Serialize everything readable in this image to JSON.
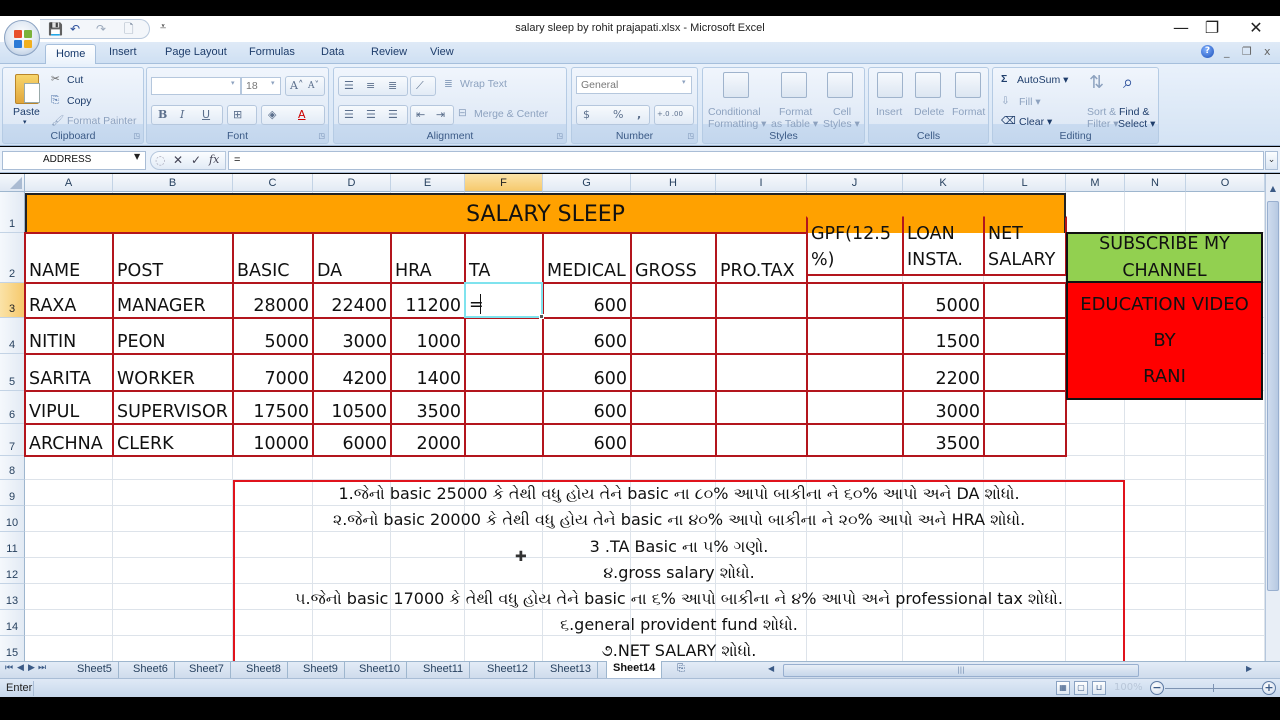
{
  "window": {
    "title": "salary sleep by rohit prajapati.xlsx - Microsoft Excel",
    "controls": {
      "minimize": "—",
      "restore": "❐",
      "close": "✕"
    },
    "doc_controls": {
      "help": "?",
      "minimize": "_",
      "restore": "❐",
      "close": "x"
    }
  },
  "quick_access": {
    "save": "💾",
    "undo": "↶",
    "redo": "↷",
    "print_preview": "🗋",
    "customize": "⩡"
  },
  "ribbon": {
    "tabs": [
      "Home",
      "Insert",
      "Page Layout",
      "Formulas",
      "Data",
      "Review",
      "View"
    ],
    "active_tab": "Home",
    "clipboard": {
      "label": "Clipboard",
      "paste": "Paste",
      "cut": "Cut",
      "copy": "Copy",
      "format_painter": "Format Painter"
    },
    "font": {
      "label": "Font",
      "font_name": "",
      "font_size": "18",
      "bold": "B",
      "italic": "I",
      "underline": "U"
    },
    "alignment": {
      "label": "Alignment",
      "wrap_text": "Wrap Text",
      "merge_center": "Merge & Center"
    },
    "number": {
      "label": "Number",
      "format": "General",
      "currency": "$",
      "percent": "%",
      "comma": ",",
      "inc_decimal": "+.0 .00",
      "dec_decimal": ".00 →.0"
    },
    "styles": {
      "label": "Styles",
      "conditional": [
        "Conditional",
        "Formatting ▾"
      ],
      "format_table": [
        "Format",
        "as Table ▾"
      ],
      "cell_styles": [
        "Cell",
        "Styles ▾"
      ]
    },
    "cells": {
      "label": "Cells",
      "insert": "Insert",
      "delete": "Delete",
      "format": "Format"
    },
    "editing": {
      "label": "Editing",
      "autosum": "AutoSum ▾",
      "fill": "Fill ▾",
      "clear": "Clear ▾",
      "sort_filter": [
        "Sort &",
        "Filter ▾"
      ],
      "find_select": [
        "Find &",
        "Select ▾"
      ]
    }
  },
  "formula_bar": {
    "name_box": "ADDRESS",
    "cancel": "✕",
    "enter": "✓",
    "fx": "fx",
    "content": "="
  },
  "columns": [
    "A",
    "B",
    "C",
    "D",
    "E",
    "F",
    "G",
    "H",
    "I",
    "J",
    "K",
    "L",
    "M",
    "N",
    "O"
  ],
  "selected_column": "F",
  "rows": [
    "1",
    "2",
    "3",
    "4",
    "5",
    "6",
    "7",
    "8",
    "9",
    "10",
    "11",
    "12",
    "13",
    "14",
    "15"
  ],
  "selected_row": "3",
  "sheet": {
    "title": "SALARY SLEEP",
    "headers": [
      "NAME",
      "POST",
      "BASIC",
      "DA",
      "HRA",
      "TA",
      "MEDICAL",
      "GROSS",
      "PRO.TAX",
      "GPF(12.5 %)",
      "LOAN INSTA.",
      "NET SALARY"
    ],
    "header_lines": {
      "gpf": [
        "GPF(12.5",
        "%)"
      ],
      "loan": [
        "LOAN",
        "INSTA."
      ],
      "net": [
        "NET",
        "SALARY"
      ]
    },
    "employees": [
      {
        "name": "RAXA",
        "post": "MANAGER",
        "basic": "28000",
        "da": "22400",
        "hra": "11200",
        "ta": "=",
        "medical": "600",
        "gross": "",
        "pro_tax": "",
        "gpf": "",
        "loan": "5000",
        "net": ""
      },
      {
        "name": "NITIN",
        "post": "PEON",
        "basic": "5000",
        "da": "3000",
        "hra": "1000",
        "ta": "",
        "medical": "600",
        "gross": "",
        "pro_tax": "",
        "gpf": "",
        "loan": "1500",
        "net": ""
      },
      {
        "name": "SARITA",
        "post": "WORKER",
        "basic": "7000",
        "da": "4200",
        "hra": "1400",
        "ta": "",
        "medical": "600",
        "gross": "",
        "pro_tax": "",
        "gpf": "",
        "loan": "2200",
        "net": ""
      },
      {
        "name": "VIPUL",
        "post": "SUPERVISOR",
        "basic": "17500",
        "da": "10500",
        "hra": "3500",
        "ta": "",
        "medical": "600",
        "gross": "",
        "pro_tax": "",
        "gpf": "",
        "loan": "3000",
        "net": ""
      },
      {
        "name": "ARCHNA",
        "post": "CLERK",
        "basic": "10000",
        "da": "6000",
        "hra": "2000",
        "ta": "",
        "medical": "600",
        "gross": "",
        "pro_tax": "",
        "gpf": "",
        "loan": "3500",
        "net": ""
      }
    ],
    "subscribe": [
      "SUBSCRIBE MY",
      "CHANNEL"
    ],
    "education": [
      "EDUCATION VIDEO",
      "BY",
      "RANI"
    ],
    "notes": [
      "1.જેનો basic 25000 કે તેથી વધુ હોય તેને basic ના ૮૦% આપો બાકીના ને ૬૦% આપો અને DA શોધો.",
      "૨.જેનો basic 20000 કે તેથી વધુ હોય તેને basic ના ૪૦% આપો બાકીના ને ૨૦% આપો અને HRA શોધો.",
      "3 .TA Basic ના ૫% ગણો.",
      "૪.gross salary શોધો.",
      "૫.જેનો basic 17000 કે તેથી વધુ હોય તેને basic ના ૬% આપો બાકીના ને ૪% આપો અને professional tax શોધો.",
      "૬.general provident fund શોધો.",
      "૭.NET SALARY શોધો."
    ]
  },
  "sheet_tabs": {
    "nav": [
      "⏮",
      "◀",
      "▶",
      "⏭"
    ],
    "tabs": [
      "Sheet5",
      "Sheet6",
      "Sheet7",
      "Sheet8",
      "Sheet9",
      "Sheet10",
      "Sheet11",
      "Sheet12",
      "Sheet13",
      "Sheet14"
    ],
    "active": "Sheet14"
  },
  "status_bar": {
    "mode": "Enter",
    "zoom": "100%",
    "zoom_out": "−",
    "zoom_in": "+"
  }
}
